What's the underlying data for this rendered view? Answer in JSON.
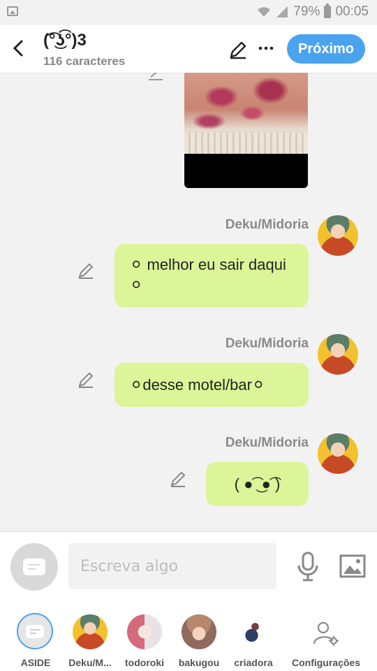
{
  "status_bar": {
    "battery": "79%",
    "time": "00:05"
  },
  "header": {
    "title": "(͡°͜ʖ͡°)3",
    "subtitle": "116 caracteres",
    "next_label": "Próximo"
  },
  "messages": [
    {
      "sender": "Deku/Midoria",
      "text": "⚪ melhor eu sair daqui ⚪"
    },
    {
      "sender": "Deku/Midoria",
      "text": "⚪desse motel/bar⚪"
    },
    {
      "sender": "Deku/Midoria",
      "text": "( ●͡ ͜ ●͡ )"
    }
  ],
  "composer": {
    "placeholder": "Escreva algo"
  },
  "bottom_nav": [
    {
      "label": "ASIDE"
    },
    {
      "label": "Deku/M..."
    },
    {
      "label": "todoroki"
    },
    {
      "label": "bakugou"
    },
    {
      "label": "criadora"
    },
    {
      "label": "Configurações"
    }
  ],
  "colors": {
    "accent": "#4aa3ef",
    "bubble": "#dcf598",
    "background": "#f2f2f2"
  }
}
